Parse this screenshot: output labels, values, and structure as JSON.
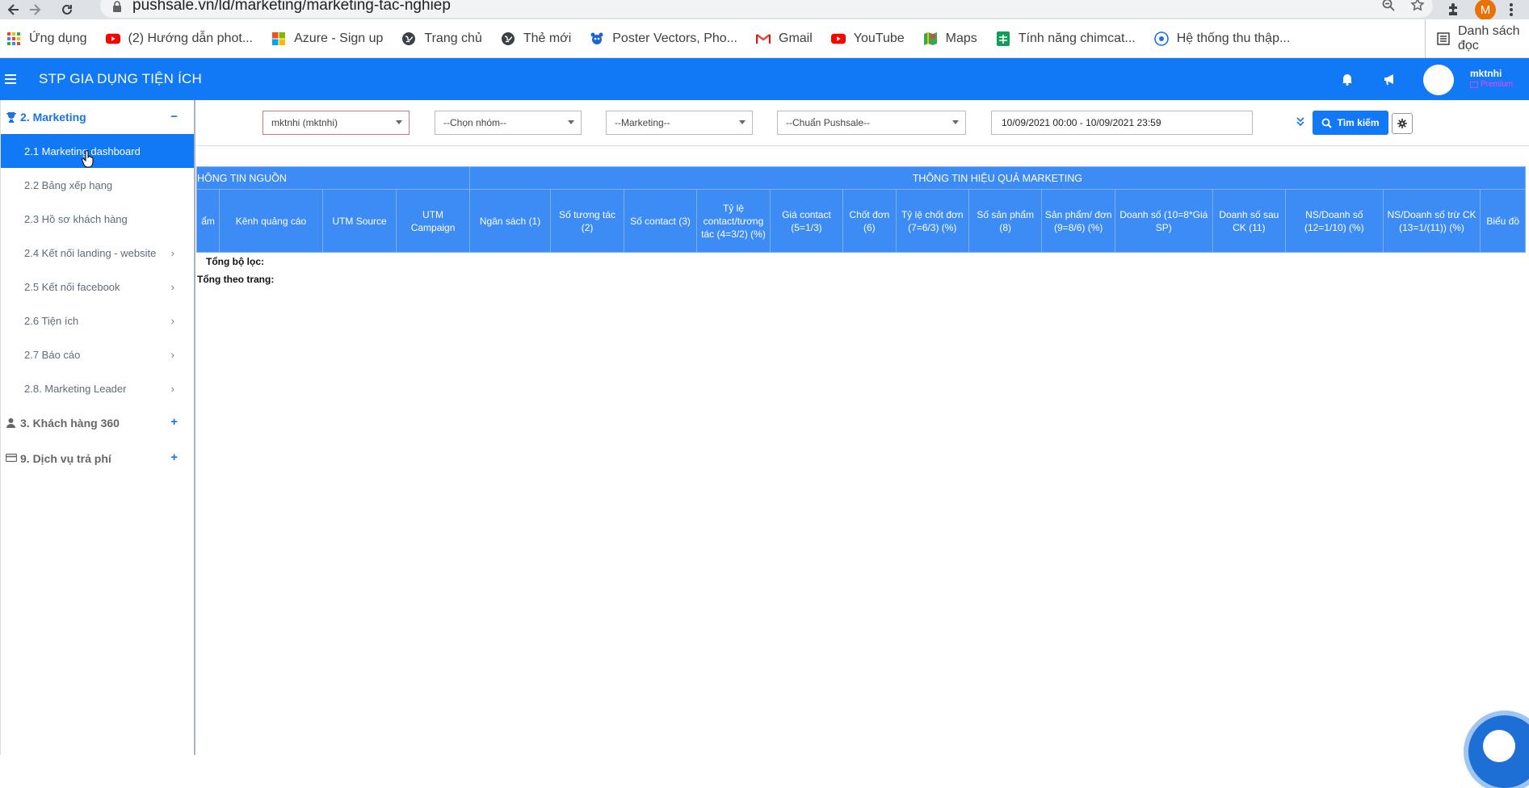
{
  "browser": {
    "url": "pushsale.vn/ld/marketing/marketing-tac-nghiep",
    "profile_initial": "M",
    "bookmarks": [
      {
        "label": "Ứng dụng",
        "icon": "apps-grid-icon"
      },
      {
        "label": "(2) Hướng dẫn phot...",
        "icon": "youtube-icon"
      },
      {
        "label": "Azure - Sign up",
        "icon": "microsoft-icon"
      },
      {
        "label": "Trang chủ",
        "icon": "globe-icon"
      },
      {
        "label": "Thẻ mới",
        "icon": "globe-icon"
      },
      {
        "label": "Poster Vectors, Pho...",
        "icon": "freepik-icon"
      },
      {
        "label": "Gmail",
        "icon": "gmail-icon"
      },
      {
        "label": "YouTube",
        "icon": "youtube-icon"
      },
      {
        "label": "Maps",
        "icon": "maps-icon"
      },
      {
        "label": "Tính năng chimcat...",
        "icon": "sheets-icon"
      },
      {
        "label": "Hệ thống thu thập...",
        "icon": "site-icon"
      }
    ],
    "reading_list": "Danh sách đọc"
  },
  "header": {
    "title": "STP GIA DỤNG TIỆN ÍCH",
    "user_name": "mktnhi",
    "user_plan": "Premium"
  },
  "sidebar": {
    "groups": [
      {
        "label": "2. Marketing",
        "toggle": "−",
        "items": [
          {
            "label": "2.1 Marketing dashboard",
            "chevron": ""
          },
          {
            "label": "2.2 Bảng xếp hạng",
            "chevron": ""
          },
          {
            "label": "2.3 Hồ sơ khách hàng",
            "chevron": ""
          },
          {
            "label": "2.4 Kết nối landing - website",
            "chevron": "›"
          },
          {
            "label": "2.5 Kết nối facebook",
            "chevron": "›"
          },
          {
            "label": "2.6 Tiện ích",
            "chevron": "›"
          },
          {
            "label": "2.7 Báo cáo",
            "chevron": "›"
          },
          {
            "label": "2.8. Marketing Leader",
            "chevron": "›"
          }
        ]
      },
      {
        "label": "3. Khách hàng 360",
        "toggle": "+"
      },
      {
        "label": "9. Dịch vụ trả phí",
        "toggle": "+"
      }
    ]
  },
  "filters": {
    "user": "mktnhi (mktnhi)",
    "group": "--Chọn nhóm--",
    "marketing": "--Marketing--",
    "standard": "--Chuẩn Pushsale--",
    "date_range": "10/09/2021 00:00 - 10/09/2021 23:59",
    "search_label": "Tìm kiếm"
  },
  "table": {
    "group_headers": [
      "HÔNG TIN NGUỒN",
      "THÔNG TIN HIỆU QUẢ MARKETING"
    ],
    "columns": [
      "ẩm",
      "Kênh quảng cáo",
      "UTM Source",
      "UTM Campaign",
      "Ngân sách (1)",
      "Số tương tác (2)",
      "Số contact (3)",
      "Tỷ lệ contact/tương tác (4=3/2) (%)",
      "Giá contact (5=1/3)",
      "Chốt đơn (6)",
      "Tỷ lệ chốt đơn (7=6/3) (%)",
      "Số sản phẩm (8)",
      "Sản phẩm/ đơn (9=8/6) (%)",
      "Doanh số (10=8*Giá SP)",
      "Doanh số sau CK (11)",
      "NS/Doanh số (12=1/10) (%)",
      "NS/Doanh số trừ CK (13=1/(11)) (%)",
      "Biểu đồ"
    ],
    "total_filter": "Tổng bộ lọc:",
    "total_page": "Tổng theo trang:"
  }
}
